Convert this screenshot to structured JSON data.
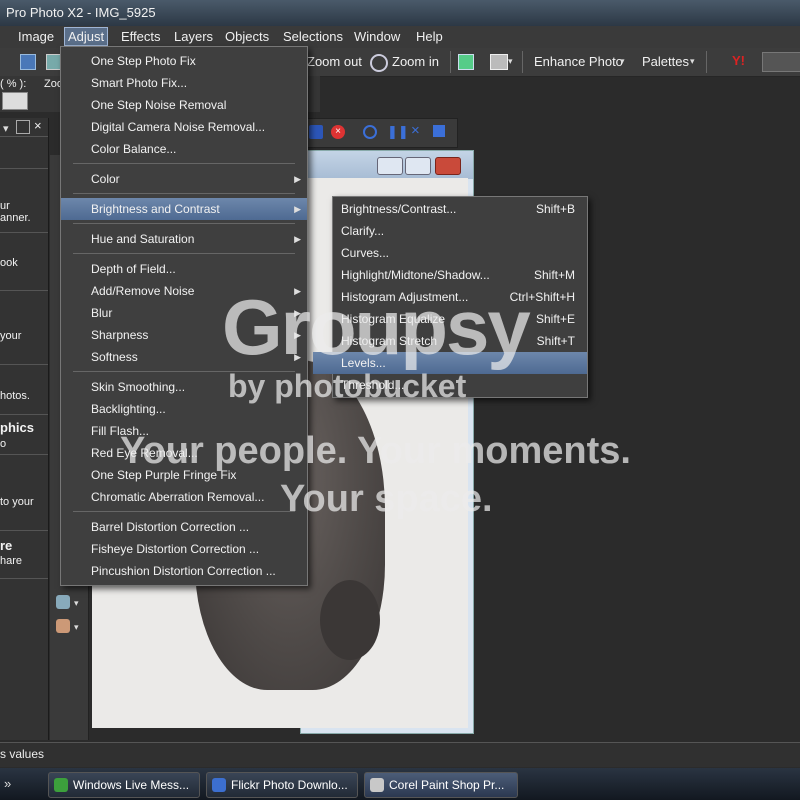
{
  "window": {
    "title": "Pro Photo X2 - IMG_5925"
  },
  "menubar": [
    "Image",
    "Adjust",
    "Effects",
    "Layers",
    "Objects",
    "Selections",
    "Window",
    "Help"
  ],
  "toolbar": {
    "zoom_out": "Zoom out",
    "zoom_in": "Zoom in",
    "enhance_photo": "Enhance Photo",
    "palettes": "Palettes",
    "percent_label": "( % ):",
    "zoom_label": "Zoo"
  },
  "left_panel": {
    "fragments": [
      "ur",
      "anner.",
      "ook",
      "your",
      "hotos.",
      "phics",
      "o",
      "to your",
      "re",
      "hare"
    ]
  },
  "adjust_menu": {
    "groups": [
      [
        {
          "label": "One Step Photo Fix"
        },
        {
          "label": "Smart Photo Fix..."
        },
        {
          "label": "One Step Noise Removal"
        },
        {
          "label": "Digital Camera Noise Removal..."
        },
        {
          "label": "Color Balance..."
        }
      ],
      [
        {
          "label": "Color",
          "submenu": true
        }
      ],
      [
        {
          "label": "Brightness and Contrast",
          "submenu": true,
          "highlighted": true
        }
      ],
      [
        {
          "label": "Hue and Saturation",
          "submenu": true
        }
      ],
      [
        {
          "label": "Depth of Field..."
        },
        {
          "label": "Add/Remove Noise",
          "submenu": true
        },
        {
          "label": "Blur",
          "submenu": true
        },
        {
          "label": "Sharpness",
          "submenu": true
        },
        {
          "label": "Softness",
          "submenu": true
        }
      ],
      [
        {
          "label": "Skin Smoothing..."
        },
        {
          "label": "Backlighting..."
        },
        {
          "label": "Fill Flash..."
        },
        {
          "label": "Red Eye Removal..."
        },
        {
          "label": "One Step Purple Fringe Fix"
        },
        {
          "label": "Chromatic Aberration Removal..."
        }
      ],
      [
        {
          "label": "Barrel Distortion Correction ..."
        },
        {
          "label": "Fisheye Distortion Correction ..."
        },
        {
          "label": "Pincushion Distortion Correction ..."
        }
      ]
    ]
  },
  "brightness_submenu": {
    "items": [
      {
        "label": "Brightness/Contrast...",
        "shortcut": "Shift+B"
      },
      {
        "label": "Clarify...",
        "shortcut": ""
      },
      {
        "label": "Curves...",
        "shortcut": ""
      },
      {
        "label": "Highlight/Midtone/Shadow...",
        "shortcut": "Shift+M"
      },
      {
        "label": "Histogram Adjustment...",
        "shortcut": "Ctrl+Shift+H"
      },
      {
        "label": "Histogram Equalize",
        "shortcut": "Shift+E"
      },
      {
        "label": "Histogram Stretch",
        "shortcut": "Shift+T"
      },
      {
        "label": "Levels...",
        "shortcut": "",
        "highlighted": true
      },
      {
        "label": "Threshold...",
        "shortcut": ""
      }
    ]
  },
  "watermark": {
    "brand": "Groupsy",
    "sub": "by photobucket",
    "line1": "Your people. Your moments.",
    "line2": "Your space."
  },
  "status": {
    "text": "s values"
  },
  "taskbar": {
    "tasks": [
      {
        "label": "Windows Live Mess...",
        "active": false
      },
      {
        "label": "Flickr Photo Downlo...",
        "active": false
      },
      {
        "label": "Corel Paint Shop Pr...",
        "active": true
      }
    ]
  }
}
